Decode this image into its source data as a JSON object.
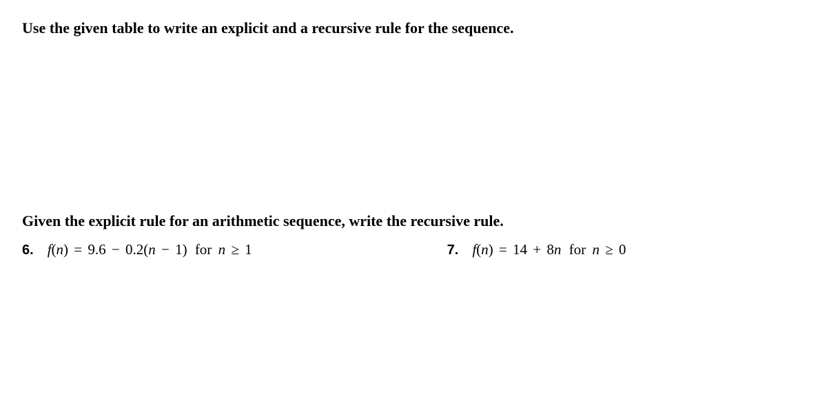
{
  "instruction1": "Use the given table to write an explicit and a recursive rule for the sequence.",
  "instruction2": "Given the explicit rule for an arithmetic sequence, write the recursive rule.",
  "problems": {
    "p6": {
      "number": "6.",
      "func": "f",
      "arg": "n",
      "eq": "=",
      "a": "9.6",
      "minus": "−",
      "b": "0.2",
      "arg2": "n",
      "minus2": "−",
      "one": "1",
      "for": "for",
      "cond_var": "n",
      "ge": "≥",
      "cond_val": "1"
    },
    "p7": {
      "number": "7.",
      "func": "f",
      "arg": "n",
      "eq": "=",
      "a": "14",
      "plus": "+",
      "b": "8",
      "var": "n",
      "for": "for",
      "cond_var": "n",
      "ge": "≥",
      "cond_val": "0"
    }
  }
}
